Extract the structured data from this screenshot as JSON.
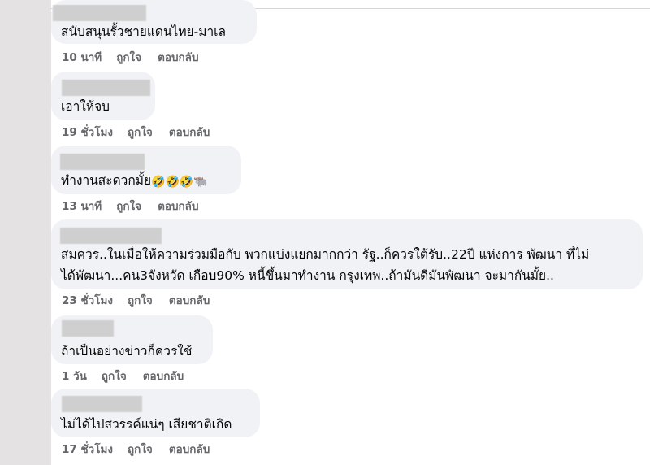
{
  "comments": [
    {
      "text_lines": [
        "สนับสนุนรั้วชายแดนไทย-มาเล"
      ],
      "time": "10 นาที",
      "like": "ถูกใจ",
      "reply": "ตอบกลับ"
    },
    {
      "text_lines": [
        "เอาให้จบ"
      ],
      "time": "19 ชั่วโมง",
      "like": "ถูกใจ",
      "reply": "ตอบกลับ"
    },
    {
      "text_lines": [
        "ทำงานสะดวกมั้ย"
      ],
      "emojis": [
        "🤣",
        "🤣",
        "🤣",
        "🐃"
      ],
      "emoji_icons": [
        "rolling-laughing-emoji-icon",
        "rolling-laughing-emoji-icon",
        "rolling-laughing-emoji-icon",
        "water-buffalo-emoji-icon"
      ],
      "time": "13 นาที",
      "like": "ถูกใจ",
      "reply": "ตอบกลับ"
    },
    {
      "text_lines": [
        "สมควร..ในเมื่อให้ความร่วมมือกับ พวกแบ่งแยกมากกว่า รัฐ..ก็ควรใต้รับ..22ปี แห่งการ พัฒนา ที่ไม่",
        "ได้พัฒนา...คน3จังหวัด เกือบ90% หนี้ขึ้นมาทำงาน กรุงเทพ..ถ้ามันดีมันพัฒนา จะมากันมั้ย.."
      ],
      "time": "23 ชั่วโมง",
      "like": "ถูกใจ",
      "reply": "ตอบกลับ"
    },
    {
      "text_lines": [
        "ถ้าเป็นอย่างข่าวก็ควรใช้"
      ],
      "time": "1 วัน",
      "like": "ถูกใจ",
      "reply": "ตอบกลับ"
    },
    {
      "text_lines": [
        "ไม่ได้ไปสวรรค์แน่ๆ เสียชาติเกิด"
      ],
      "time": "17 ชั่วโมง",
      "like": "ถูกใจ",
      "reply": "ตอบกลับ"
    }
  ],
  "colors": {
    "bubble": "#f0f2f5",
    "meta_text": "#65676b",
    "left_strip": "#e4e2e2",
    "redaction": "#cfcfcf"
  }
}
